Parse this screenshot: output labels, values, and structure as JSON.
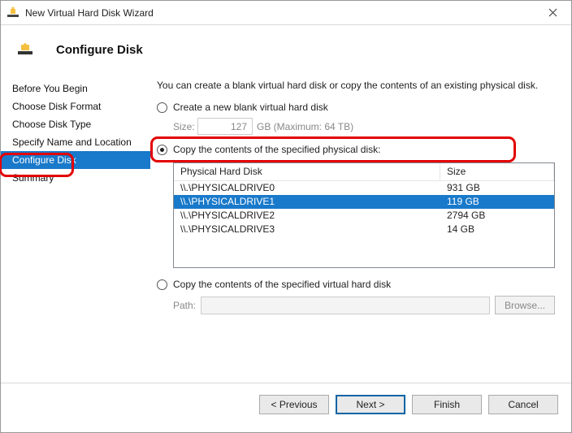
{
  "window": {
    "title": "New Virtual Hard Disk Wizard"
  },
  "header": {
    "title": "Configure Disk"
  },
  "sidebar": {
    "items": [
      {
        "label": "Before You Begin"
      },
      {
        "label": "Choose Disk Format"
      },
      {
        "label": "Choose Disk Type"
      },
      {
        "label": "Specify Name and Location"
      },
      {
        "label": "Configure Disk"
      },
      {
        "label": "Summary"
      }
    ]
  },
  "content": {
    "intro": "You can create a blank virtual hard disk or copy the contents of an existing physical disk.",
    "option_blank": "Create a new blank virtual hard disk",
    "size_label": "Size:",
    "size_value": "127",
    "size_suffix": "GB (Maximum: 64 TB)",
    "option_copy_physical": "Copy the contents of the specified physical disk:",
    "disk_header_name": "Physical Hard Disk",
    "disk_header_size": "Size",
    "disks": [
      {
        "name": "\\\\.\\PHYSICALDRIVE0",
        "size": "931 GB"
      },
      {
        "name": "\\\\.\\PHYSICALDRIVE1",
        "size": "119 GB"
      },
      {
        "name": "\\\\.\\PHYSICALDRIVE2",
        "size": "2794 GB"
      },
      {
        "name": "\\\\.\\PHYSICALDRIVE3",
        "size": "14 GB"
      }
    ],
    "option_copy_virtual": "Copy the contents of the specified virtual hard disk",
    "path_label": "Path:",
    "browse_label": "Browse..."
  },
  "footer": {
    "prev": "< Previous",
    "next": "Next >",
    "finish": "Finish",
    "cancel": "Cancel"
  }
}
